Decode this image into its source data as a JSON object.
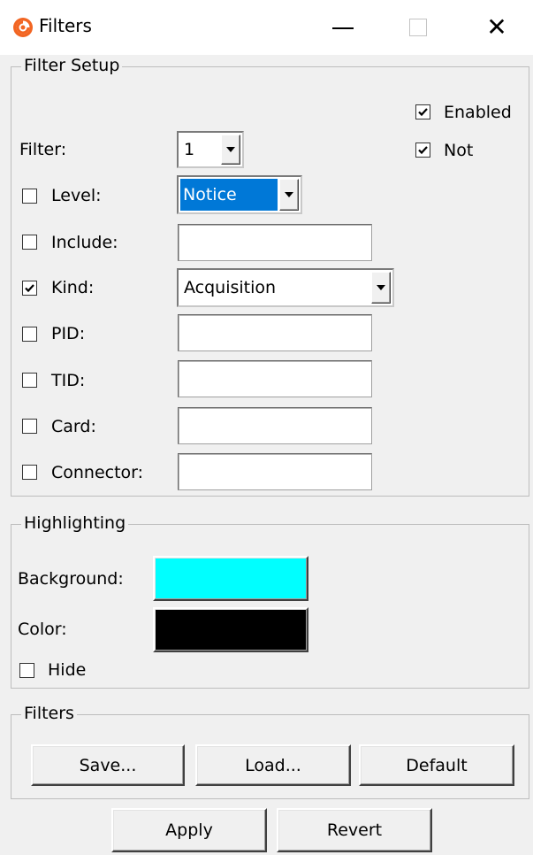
{
  "window": {
    "title": "Filters",
    "minimize_glyph": "",
    "close_glyph": "✕"
  },
  "filter_setup": {
    "group_title": "Filter Setup",
    "enabled": {
      "label": "Enabled",
      "checked": true
    },
    "not": {
      "label": "Not",
      "checked": true
    },
    "filter": {
      "label": "Filter:",
      "value": "1"
    },
    "level": {
      "label": "Level:",
      "checked": false,
      "value": "Notice"
    },
    "include": {
      "label": "Include:",
      "checked": false,
      "value": ""
    },
    "kind": {
      "label": "Kind:",
      "checked": true,
      "value": "Acquisition"
    },
    "pid": {
      "label": "PID:",
      "checked": false,
      "value": ""
    },
    "tid": {
      "label": "TID:",
      "checked": false,
      "value": ""
    },
    "card": {
      "label": "Card:",
      "checked": false,
      "value": ""
    },
    "connector": {
      "label": "Connector:",
      "checked": false,
      "value": ""
    }
  },
  "highlighting": {
    "group_title": "Highlighting",
    "background": {
      "label": "Background:",
      "color": "#00ffff"
    },
    "color": {
      "label": "Color:",
      "color": "#000000"
    },
    "hide": {
      "label": "Hide",
      "checked": false
    }
  },
  "filters_group": {
    "group_title": "Filters",
    "save_label": "Save...",
    "load_label": "Load...",
    "default_label": "Default"
  },
  "footer": {
    "apply_label": "Apply",
    "revert_label": "Revert"
  },
  "icons": {
    "app": "app-logo-icon",
    "minimize": "minimize-icon",
    "maximize": "maximize-icon",
    "close": "close-icon",
    "checkmark": "checkmark-icon",
    "dropdown": "chevron-down-icon"
  },
  "colors": {
    "accent_selection": "#0078d7",
    "app_icon": "#f26522"
  }
}
